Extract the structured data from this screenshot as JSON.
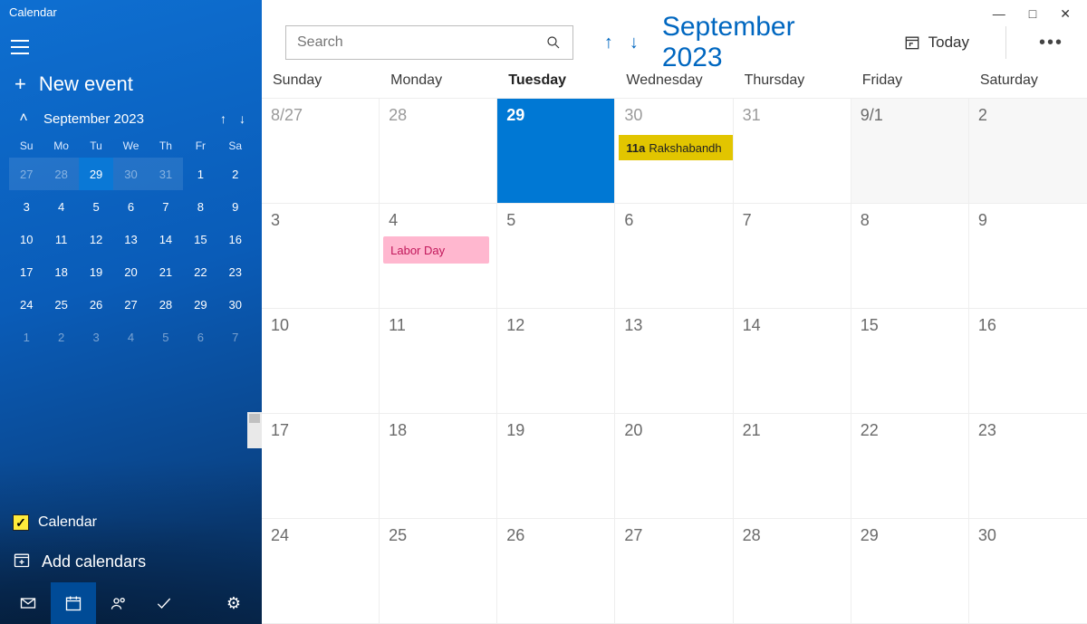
{
  "app_title": "Calendar",
  "new_event_label": "New event",
  "mini": {
    "month_label": "September 2023",
    "dow": [
      "Su",
      "Mo",
      "Tu",
      "We",
      "Th",
      "Fr",
      "Sa"
    ],
    "weeks": [
      [
        {
          "n": "27",
          "dim": true,
          "band": true
        },
        {
          "n": "28",
          "dim": true,
          "band": true
        },
        {
          "n": "29",
          "today": true,
          "band": true
        },
        {
          "n": "30",
          "dim": true,
          "band": true
        },
        {
          "n": "31",
          "dim": true,
          "band": true
        },
        {
          "n": "1"
        },
        {
          "n": "2"
        }
      ],
      [
        {
          "n": "3"
        },
        {
          "n": "4"
        },
        {
          "n": "5"
        },
        {
          "n": "6"
        },
        {
          "n": "7"
        },
        {
          "n": "8"
        },
        {
          "n": "9"
        }
      ],
      [
        {
          "n": "10"
        },
        {
          "n": "11"
        },
        {
          "n": "12"
        },
        {
          "n": "13"
        },
        {
          "n": "14"
        },
        {
          "n": "15"
        },
        {
          "n": "16"
        }
      ],
      [
        {
          "n": "17"
        },
        {
          "n": "18"
        },
        {
          "n": "19"
        },
        {
          "n": "20"
        },
        {
          "n": "21"
        },
        {
          "n": "22"
        },
        {
          "n": "23"
        }
      ],
      [
        {
          "n": "24"
        },
        {
          "n": "25"
        },
        {
          "n": "26"
        },
        {
          "n": "27"
        },
        {
          "n": "28"
        },
        {
          "n": "29"
        },
        {
          "n": "30"
        }
      ],
      [
        {
          "n": "1",
          "dim": true
        },
        {
          "n": "2",
          "dim": true
        },
        {
          "n": "3",
          "dim": true
        },
        {
          "n": "4",
          "dim": true
        },
        {
          "n": "5",
          "dim": true
        },
        {
          "n": "6",
          "dim": true
        },
        {
          "n": "7",
          "dim": true
        }
      ]
    ]
  },
  "calendar_list": {
    "item_label": "Calendar"
  },
  "add_calendars_label": "Add calendars",
  "toolbar": {
    "search_placeholder": "Search",
    "month_title": "September 2023",
    "today_label": "Today"
  },
  "dow": [
    "Sunday",
    "Monday",
    "Tuesday",
    "Wednesday",
    "Thursday",
    "Friday",
    "Saturday"
  ],
  "weeks": [
    [
      {
        "n": "8/27",
        "other": true
      },
      {
        "n": "28",
        "other": true
      },
      {
        "n": "29",
        "today": true
      },
      {
        "n": "30",
        "other": true,
        "event": {
          "kind": "yellow",
          "time": "11a",
          "title": "Rakshabandh"
        }
      },
      {
        "n": "31",
        "other": true
      },
      {
        "n": "9/1",
        "nm": true
      },
      {
        "n": "2",
        "nm": true
      }
    ],
    [
      {
        "n": "3"
      },
      {
        "n": "4",
        "event": {
          "kind": "pink",
          "title": "Labor Day"
        }
      },
      {
        "n": "5"
      },
      {
        "n": "6"
      },
      {
        "n": "7"
      },
      {
        "n": "8"
      },
      {
        "n": "9"
      }
    ],
    [
      {
        "n": "10"
      },
      {
        "n": "11"
      },
      {
        "n": "12"
      },
      {
        "n": "13"
      },
      {
        "n": "14"
      },
      {
        "n": "15"
      },
      {
        "n": "16"
      }
    ],
    [
      {
        "n": "17"
      },
      {
        "n": "18"
      },
      {
        "n": "19"
      },
      {
        "n": "20"
      },
      {
        "n": "21"
      },
      {
        "n": "22"
      },
      {
        "n": "23"
      }
    ],
    [
      {
        "n": "24"
      },
      {
        "n": "25"
      },
      {
        "n": "26"
      },
      {
        "n": "27"
      },
      {
        "n": "28"
      },
      {
        "n": "29"
      },
      {
        "n": "30"
      }
    ]
  ]
}
